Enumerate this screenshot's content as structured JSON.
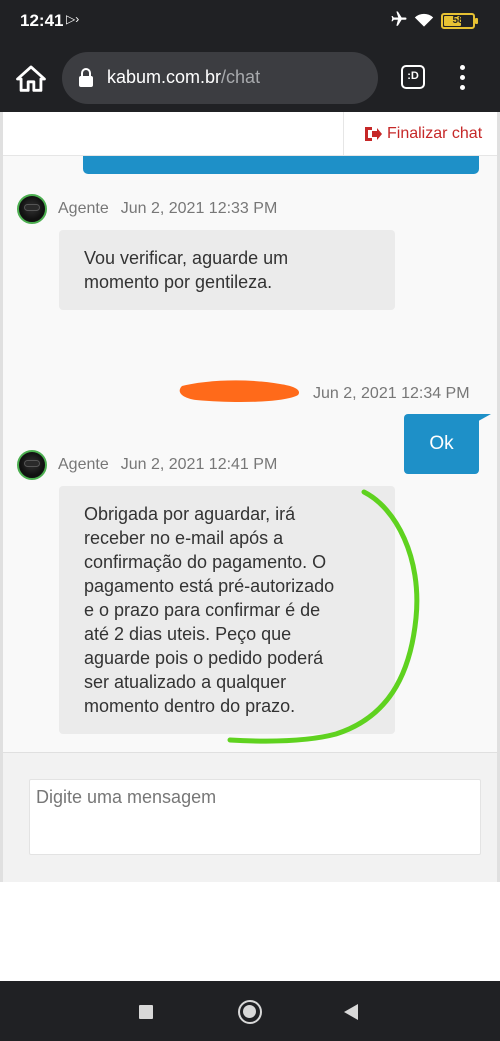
{
  "status_bar": {
    "time": "12:41",
    "battery": "58",
    "battery_level": 0.58,
    "icons": [
      "cast-icon",
      "airplane-icon",
      "wifi-icon",
      "battery-icon"
    ]
  },
  "browser": {
    "domain": "kabum.com.br",
    "path": "/chat",
    "tab_switcher_label": ":D",
    "icons": [
      "home-icon",
      "lock-icon",
      "tab-switcher-icon",
      "menu-dots-icon"
    ]
  },
  "chat_header": {
    "finalize_label": "Finalizar chat",
    "finalize_icon": "sign-out-icon"
  },
  "messages": [
    {
      "sender": "Agente",
      "time": "Jun 2, 2021 12:33 PM",
      "lines": [
        "Vou verificar, aguarde um",
        "momento por gentileza."
      ]
    },
    {
      "sender": "",
      "time": "Jun 2, 2021 12:34 PM",
      "text": "Ok"
    },
    {
      "sender": "Agente",
      "time": "Jun 2, 2021 12:41 PM",
      "lines": [
        "Obrigada por aguardar, irá",
        "receber no e-mail após a",
        "confirmação do pagamento. O",
        "pagamento está pré-autorizado",
        "e o prazo para confirmar é de",
        "até 2 dias uteis. Peço que",
        "aguarde pois o pedido poderá",
        "ser atualizado a qualquer",
        "momento dentro do prazo."
      ]
    }
  ],
  "composer": {
    "placeholder": "Digite uma mensagem"
  },
  "colors": {
    "accent_blue": "#1e90c8",
    "finalize_red": "#c62828",
    "annotation_green": "#5fd21f",
    "redaction_orange": "#ff6a1a"
  },
  "nav_bar": {
    "icons": [
      "recents-icon",
      "home-circle-icon",
      "back-icon"
    ]
  }
}
